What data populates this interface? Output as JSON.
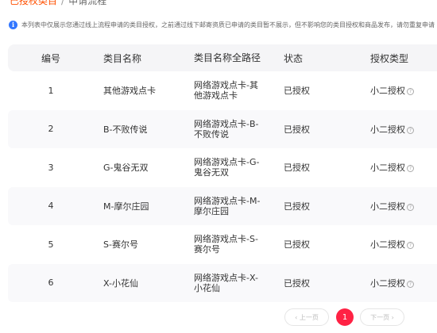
{
  "breadcrumb": {
    "link": "已授权类目",
    "separator": "/",
    "current": "申请流程"
  },
  "notice": {
    "icon": "info-icon",
    "text": "本列表中仅展示您通过线上流程申请的类目授权，之前通过线下邮寄资质已申请的类目暂不展示，但不影响您的类目授权和商品发布，请勿重复申请"
  },
  "table": {
    "headers": [
      "编号",
      "类目名称",
      "类目名称全路径",
      "状态",
      "授权类型"
    ],
    "rows": [
      {
        "id": "1",
        "name": "其他游戏点卡",
        "path": "网络游戏点卡-其他游戏点卡",
        "status": "已授权",
        "auth": "小二授权"
      },
      {
        "id": "2",
        "name": "B-不败传说",
        "path": "网络游戏点卡-B-不败传说",
        "status": "已授权",
        "auth": "小二授权"
      },
      {
        "id": "3",
        "name": "G-鬼谷无双",
        "path": "网络游戏点卡-G-鬼谷无双",
        "status": "已授权",
        "auth": "小二授权"
      },
      {
        "id": "4",
        "name": "M-摩尔庄园",
        "path": "网络游戏点卡-M-摩尔庄园",
        "status": "已授权",
        "auth": "小二授权"
      },
      {
        "id": "5",
        "name": "S-赛尔号",
        "path": "网络游戏点卡-S-赛尔号",
        "status": "已授权",
        "auth": "小二授权"
      },
      {
        "id": "6",
        "name": "X-小花仙",
        "path": "网络游戏点卡-X-小花仙",
        "status": "已授权",
        "auth": "小二授权"
      }
    ]
  },
  "pager": {
    "prev": "‹ 上一页",
    "current": "1",
    "next": "下一页 ›"
  },
  "colors": {
    "accent": "#ff5000",
    "page_active": "#ff2244",
    "info": "#3377ff"
  }
}
